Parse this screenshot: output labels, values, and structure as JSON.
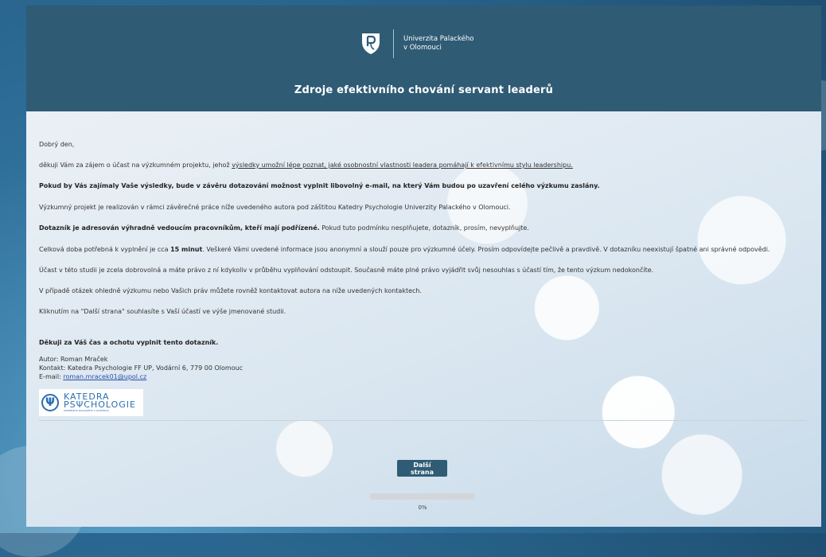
{
  "header": {
    "university_line1": "Univerzita Palackého",
    "university_line2": "v Olomouci",
    "title": "Zdroje efektivního chování servant leaderů"
  },
  "content": {
    "greeting": "Dobrý den,",
    "p1_prefix": "děkuji Vám za zájem o účast na výzkumném projektu, jehož ",
    "p1_underlined": "výsledky umožní lépe poznat, jaké osobnostní vlastnosti leadera pomáhají k efektivnímu stylu leadershipu.",
    "p2_bold": "Pokud by Vás zajímaly Vaše výsledky, bude v závěru dotazování možnost vyplnit libovolný e-mail, na který Vám budou po uzavření celého výzkumu zaslány.",
    "p3": "Výzkumný projekt je realizován v rámci závěrečné práce níže uvedeného autora pod záštitou Katedry Psychologie Univerzity Palackého v Olomouci.",
    "p4_bold": "Dotazník je adresován výhradně vedoucím pracovníkům, kteří mají podřízené.",
    "p4_rest": " Pokud tuto podmínku nesplňujete, dotazník, prosím, nevyplňujte.",
    "p5_prefix": "Celková doba potřebná k vyplnění je cca ",
    "p5_bold": "15 minut",
    "p5_rest": ". Veškeré Vámi uvedené informace jsou anonymní a slouží pouze pro výzkumné účely. Prosím odpovídejte pečlivě a pravdivě. V dotazníku neexistují špatné ani správné odpovědi.",
    "p6": "Účast v této studii je zcela dobrovolná a máte právo z ní kdykoliv v průběhu vyplňování odstoupit. Současně máte plné právo vyjádřit svůj nesouhlas s účastí tím, že tento výzkum nedokončíte.",
    "p7": "V případě otázek ohledně výzkumu nebo Vašich práv můžete rovněž kontaktovat autora na níže uvedených kontaktech.",
    "p8": "Kliknutím na \"Další strana\" souhlasíte s Vaší účastí ve výše jmenované studii.",
    "thanks_bold": "Děkuji za Váš čas a ochotu vyplnit tento dotazník.",
    "author": "Autor: Roman Mraček",
    "contact": "Kontakt: Katedra Psychologie FF UP, Vodární 6, 779 00 Olomouc",
    "email_label": "E-mail: ",
    "email": "roman.mracek01@upol.cz"
  },
  "katedra_logo": {
    "line1": "KATEDRA",
    "line2": "PSΨCHOLOGIE",
    "line3": "UNIVERZITA PALACKÉHO V OLOMOUCI"
  },
  "footer": {
    "next_label": "Další strana",
    "progress_text": "0%",
    "progress_value": 0
  },
  "colors": {
    "header_bg": "#2f5b75",
    "button_bg": "#2f5b75",
    "link": "#2a4fa8"
  }
}
